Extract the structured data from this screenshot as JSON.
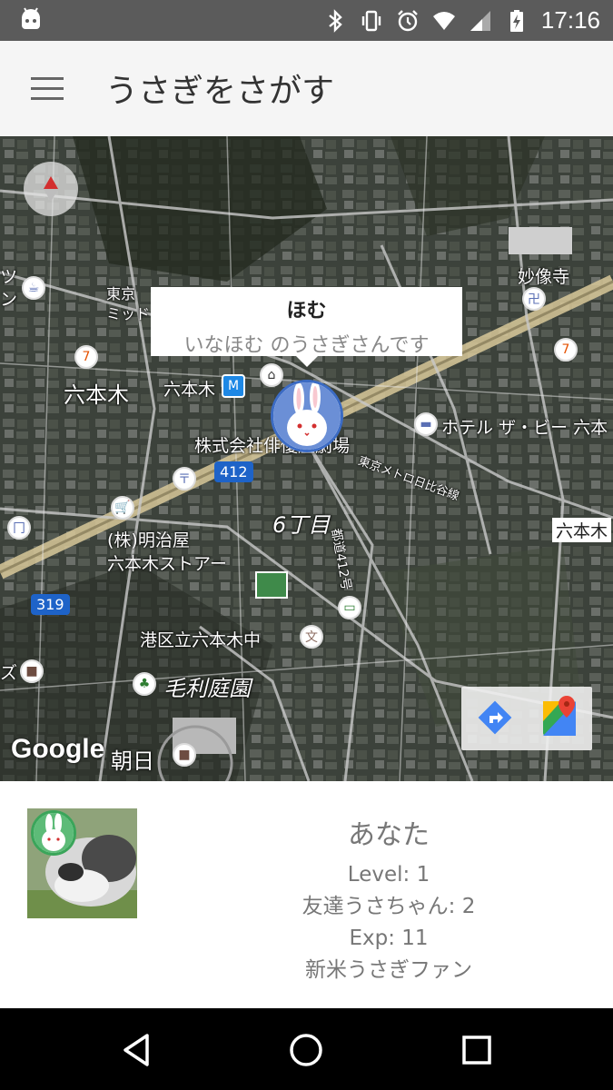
{
  "status_bar": {
    "time": "17:16",
    "icons": [
      "android-icon",
      "bluetooth-icon",
      "vibrate-icon",
      "alarm-icon",
      "wifi-icon",
      "signal-icon",
      "battery-charging-icon"
    ]
  },
  "app_bar": {
    "title": "うさぎをさがす",
    "menu_icon": "hamburger-menu-icon"
  },
  "map": {
    "info_window": {
      "title": "ほむ",
      "subtitle": "いなほむ のうさぎさんです"
    },
    "labels": {
      "tsu": "ツ",
      "n": "ン",
      "tokyo": "東京",
      "mid": "ミッド",
      "myozoji": "妙像寺",
      "roppongi": "六本木",
      "roppongi_station": "六本木",
      "company": "株式会社俳優座劇場",
      "hotel": "ホテル ザ・ビー 六本",
      "route412": "412",
      "tokyo_metro": "東京メトロ日比谷線",
      "rokuchome": "6丁目",
      "meijiya": "(株)明治屋",
      "meijiya2": "六本木ストアー",
      "roppongi_right": "六本木",
      "route319": "319",
      "school": "港区立六本木中",
      "mori_garden": "毛利庭園",
      "zu": "ズ",
      "asahi": "朝日",
      "toritsu": "都道412号"
    },
    "google_logo": "Google"
  },
  "profile": {
    "name": "あなた",
    "level": "Level: 1",
    "friends": "友達うさちゃん: 2",
    "exp": "Exp: 11",
    "rank": "新米うさぎファン"
  },
  "colors": {
    "marker_border": "#3b6bc4",
    "app_bar_bg": "#f5f5f5",
    "status_bar_bg": "#5b5b5b"
  }
}
